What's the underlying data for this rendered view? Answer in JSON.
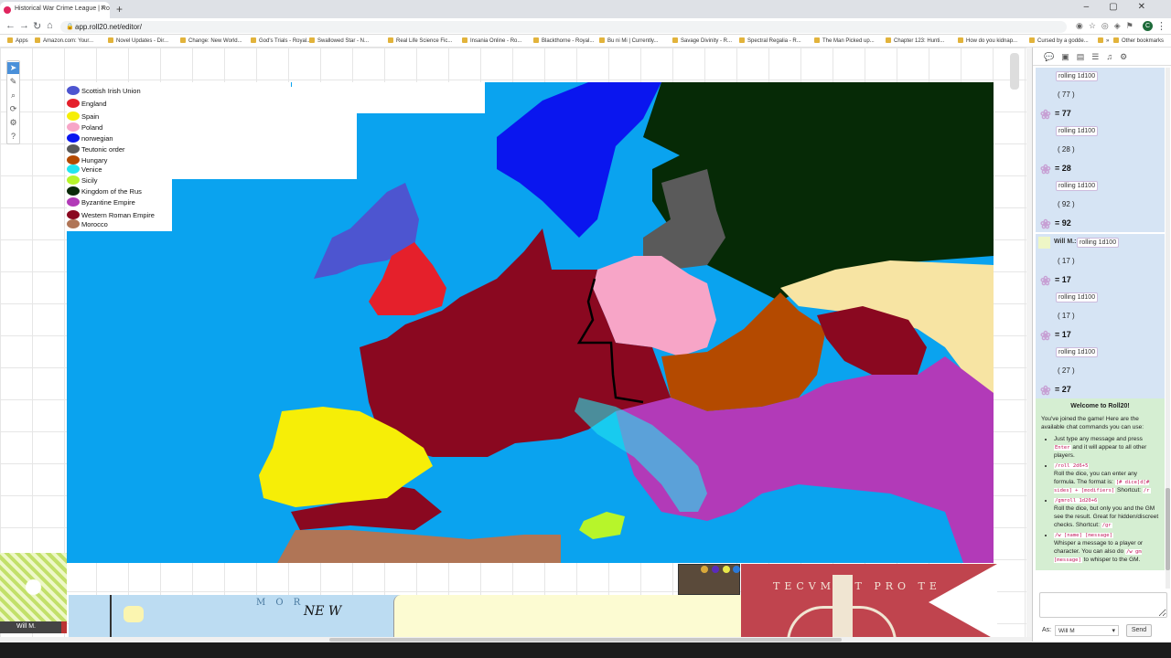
{
  "browser": {
    "tab_title": "Historical War Crime League | Ro",
    "tab_close": "×",
    "newtab": "+",
    "url": "app.roll20.net/editor/",
    "profile_initial": "C",
    "bookmarks": [
      "Apps",
      "Amazon.com: Your...",
      "Novel Updates - Dir...",
      "Change: New World...",
      "God's Trials - Royal...",
      "Swallowed Star - N...",
      "Real Life Science Fic...",
      "Insania Online - Ro...",
      "Blackthorne - Royal...",
      "Bu ni Mi | Currently...",
      "Savage Divinity - R...",
      "Spectral Regalia - R...",
      "The Man Picked up...",
      "Chapter 123: Hunti...",
      "How do you kidnap...",
      "Cursed by a godde..."
    ],
    "bookmarks_more": "»",
    "other_bookmarks": "Other bookmarks"
  },
  "legend": [
    {
      "label": "Scottish Irish Union",
      "color": "#4d55d0"
    },
    {
      "label": "England",
      "color": "#e5202b"
    },
    {
      "label": "Spain",
      "color": "#f6ee07"
    },
    {
      "label": "Poland",
      "color": "#f7a5c7"
    },
    {
      "label": "norwegian",
      "color": "#0a16ef"
    },
    {
      "label": "Teutonic order",
      "color": "#5a5a5a"
    },
    {
      "label": "Hungary",
      "color": "#b44a00"
    },
    {
      "label": "Venice",
      "color": "#22e6ef"
    },
    {
      "label": "Sicily",
      "color": "#b7f52a"
    },
    {
      "label": "Kingdom of the Rus",
      "color": "#0a2a0a"
    },
    {
      "label": "Byzantine Empire",
      "color": "#b23ab8"
    },
    {
      "label": "Western Roman Empire",
      "color": "#8a0820"
    },
    {
      "label": "Morocco",
      "color": "#b07556"
    }
  ],
  "colors": {
    "sea": "#0aa3ef",
    "poland": "#f7a5c7",
    "rus": "#062a06",
    "wre": "#8a0820",
    "hungary": "#b44a00",
    "byzantine": "#b23ab8",
    "england": "#e5202b",
    "spain": "#f6ee07",
    "scots": "#4d55d0",
    "norway": "#0a16ef",
    "teutonic": "#5a5a5a",
    "venice": "#22e6ef",
    "sicily": "#b7f52a",
    "morocco": "#b07556",
    "steppe": "#f7e4a3"
  },
  "player": {
    "name": "Will M."
  },
  "minimap_text": "M O R",
  "minimap_script": "NE W",
  "banner_text": "TECVM   ET PRO TE",
  "chat": {
    "tabs_icons": [
      "chat-icon",
      "art-icon",
      "journal-icon",
      "compendium-icon",
      "jukebox-icon",
      "settings-icon"
    ],
    "rolls": [
      {
        "cmd": "rolling 1d100",
        "paren": "( 77 )",
        "result": "= 77"
      },
      {
        "cmd": "rolling 1d100",
        "paren": "( 28 )",
        "result": "= 28"
      },
      {
        "cmd": "rolling 1d100",
        "paren": "( 92 )",
        "result": "= 92"
      }
    ],
    "rolls2_name": "Will M.:",
    "rolls2": [
      {
        "cmd": "rolling 1d100",
        "paren": "( 17 )",
        "result": "= 17"
      },
      {
        "cmd": "rolling 1d100",
        "paren": "( 17 )",
        "result": "= 17"
      },
      {
        "cmd": "rolling 1d100",
        "paren": "( 27 )",
        "result": "= 27"
      }
    ],
    "welcome_title": "Welcome to Roll20!",
    "welcome_intro": "You've joined the game! Here are the available chat commands you can use:",
    "welcome_items": [
      {
        "text1": "Just type any message and press",
        "code1": "Enter",
        "text2": "and it will appear to all other players."
      },
      {
        "code0": "/roll 2d6+5",
        "text1": "Roll the dice, you can enter any formula. The format is:",
        "code1": "[# dice]d[# sides] + [modifiers]",
        "text2": "Shortcut:",
        "code2": "/r"
      },
      {
        "code0": "/gmroll 1d20+6",
        "text1": "Roll the dice, but only you and the GM see the result. Great for hidden/discreet checks.",
        "text2": "Shortcut:",
        "code2": "/gr"
      },
      {
        "code0": "/w [name] [message]",
        "text1": "Whisper a message to a player or character. You can also do",
        "code1": "/w gm [message]",
        "text2": "to whisper to the GM."
      }
    ],
    "as_label": "As:",
    "as_value": "Will M",
    "send_label": "Send"
  }
}
